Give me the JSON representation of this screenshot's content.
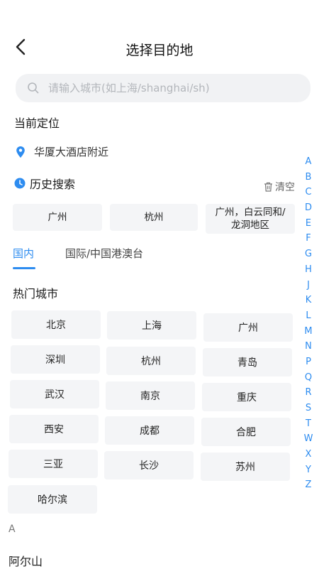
{
  "header": {
    "title": "选择目的地"
  },
  "search": {
    "placeholder": "请输入城市(如上海/shanghai/sh)"
  },
  "current_location": {
    "label": "当前定位",
    "value": "华厦大酒店附近"
  },
  "history": {
    "label": "历史搜索",
    "clear_label": "清空",
    "items": [
      "广州",
      "杭州",
      "广州，白云同和/龙洞地区"
    ]
  },
  "tabs": [
    {
      "label": "国内",
      "active": true
    },
    {
      "label": "国际/中国港澳台",
      "active": false
    }
  ],
  "hot_cities": {
    "label": "热门城市",
    "items": [
      "北京",
      "上海",
      "广州",
      "深圳",
      "杭州",
      "青岛",
      "武汉",
      "南京",
      "重庆",
      "西安",
      "成都",
      "合肥",
      "三亚",
      "长沙",
      "苏州",
      "哈尔滨"
    ]
  },
  "alphabet": [
    "A",
    "B",
    "C",
    "D",
    "E",
    "F",
    "G",
    "H",
    "J",
    "K",
    "L",
    "M",
    "N",
    "P",
    "Q",
    "R",
    "S",
    "T",
    "W",
    "X",
    "Y",
    "Z"
  ],
  "section_a": {
    "letter": "A",
    "first_city": "阿尔山"
  },
  "colors": {
    "accent": "#2d8cf0",
    "chip_bg": "#f4f5f7"
  }
}
